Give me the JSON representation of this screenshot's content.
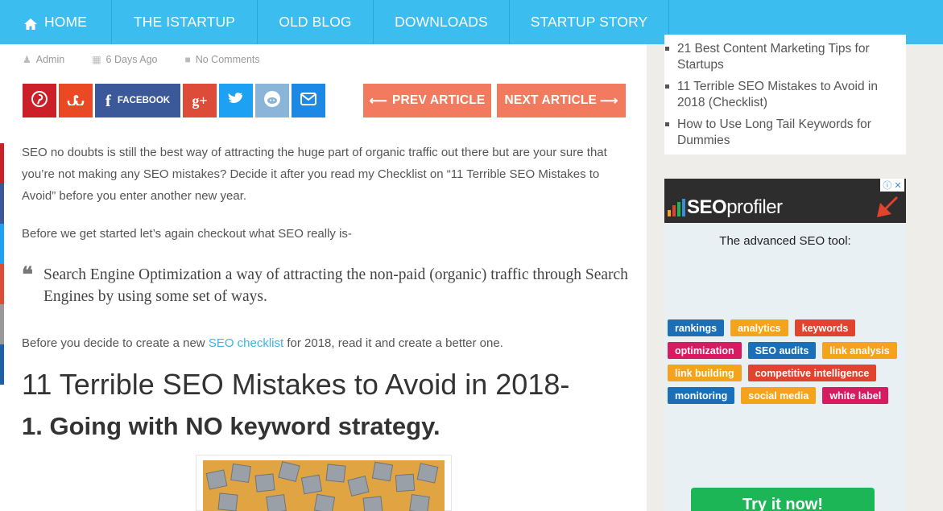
{
  "nav": {
    "items": [
      {
        "label": "HOME",
        "icon": "home-icon"
      },
      {
        "label": "THE ISTARTUP"
      },
      {
        "label": "OLD BLOG"
      },
      {
        "label": "DOWNLOADS"
      },
      {
        "label": "STARTUP STORY"
      }
    ],
    "bg_color": "#3cbdf0"
  },
  "meta": {
    "author": "Admin",
    "date": "6 Days Ago",
    "comments": "No Comments"
  },
  "share": {
    "facebook_label": "FACEBOOK",
    "buttons": [
      {
        "name": "pinterest",
        "icon": "pinterest-icon",
        "color": "#cb2027"
      },
      {
        "name": "stumbleupon",
        "icon": "stumbleupon-icon",
        "color": "#eb4924"
      },
      {
        "name": "facebook",
        "icon": "facebook-icon",
        "color": "#3b5998"
      },
      {
        "name": "google-plus",
        "icon": "google-plus-icon",
        "color": "#dd4b39"
      },
      {
        "name": "twitter",
        "icon": "twitter-icon",
        "color": "#1da1f2"
      },
      {
        "name": "reddit",
        "icon": "reddit-icon",
        "color": "#8ab4d8"
      },
      {
        "name": "email",
        "icon": "email-icon",
        "color": "#1e88e5"
      }
    ]
  },
  "article_nav": {
    "prev_label": "PREV ARTICLE",
    "next_label": "NEXT ARTICLE",
    "color": "#f27a5e"
  },
  "content": {
    "intro": "SEO no doubts is still the best way of attracting the huge part of organic traffic out there but are your sure that you’re not making any SEO mistakes? Decide it after you read my Checklist on “11 Terrible SEO Mistakes to Avoid” before you enter another new year.",
    "before_start": "Before we get started let’s again checkout what SEO really is-",
    "quote": "Search Engine Optimization a way of attracting the non-paid (organic) traffic through Search Engines by using some set of ways.",
    "decide_prefix": "Before you decide to create a new ",
    "decide_link": "SEO checklist",
    "decide_suffix": " for 2018, read it and create a better one.",
    "heading": "11 Terrible SEO Mistakes to Avoid in 2018-",
    "subheading": "1. Going with NO keyword strategy."
  },
  "recent_posts": [
    "21 Best Content Marketing Tips for Startups",
    "11 Terrible SEO Mistakes to Avoid in 2018 (Checklist)",
    "How to Use Long Tail Keywords for Dummies"
  ],
  "ad": {
    "logo_bold": "SEO",
    "logo_rest": "profiler",
    "tagline": "The advanced SEO tool:",
    "cta": "Try it now!",
    "tags": [
      [
        {
          "label": "rankings",
          "color": "#1a6fb6"
        },
        {
          "label": "analytics",
          "color": "#f5a31d"
        },
        {
          "label": "keywords",
          "color": "#e0442e"
        }
      ],
      [
        {
          "label": "optimization",
          "color": "#d81b60"
        },
        {
          "label": "SEO audits",
          "color": "#1a6fb6"
        },
        {
          "label": "link analysis",
          "color": "#f5a31d"
        }
      ],
      [
        {
          "label": "link building",
          "color": "#f5a31d"
        },
        {
          "label": "competitive intelligence",
          "color": "#e0442e"
        }
      ],
      [
        {
          "label": "monitoring",
          "color": "#1a6fb6"
        },
        {
          "label": "social media",
          "color": "#f5a31d"
        },
        {
          "label": "white label",
          "color": "#d81b60"
        }
      ]
    ]
  }
}
